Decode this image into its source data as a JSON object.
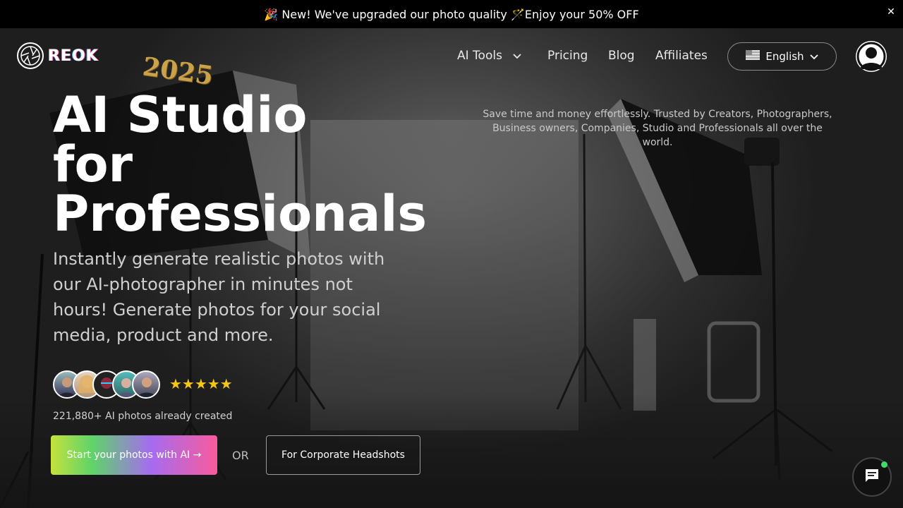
{
  "banner": {
    "text": "🎉 New! We've upgraded our photo quality 🪄Enjoy your 50% OFF",
    "close_label": "✕"
  },
  "nav": {
    "logo_text": "REOK",
    "ai_tools_label": "AI Tools",
    "pricing_label": "Pricing",
    "blog_label": "Blog",
    "affiliates_label": "Affiliates",
    "language_label": "English"
  },
  "hero": {
    "year_badge": "2025",
    "headline_line1": "AI Studio",
    "headline_line2": "for",
    "headline_line3": "Professionals",
    "tagline": "Save time and money effortlessly. Trusted by Creators, Photographers, Business owners, Companies, Studio and Professionals all over the world.",
    "subtext": "Instantly generate realistic photos with our AI-photographer in minutes not hours! Generate photos for your social media, product and more.",
    "rating_stars": "★★★★★",
    "photos_count": "221,880+ AI photos already created",
    "cta_label": "Start your photos with AI →",
    "or_label": "OR",
    "corporate_label": "For Corporate Headshots"
  },
  "colors": {
    "star": "#f5c518",
    "chat_status": "#3ddc6b"
  }
}
